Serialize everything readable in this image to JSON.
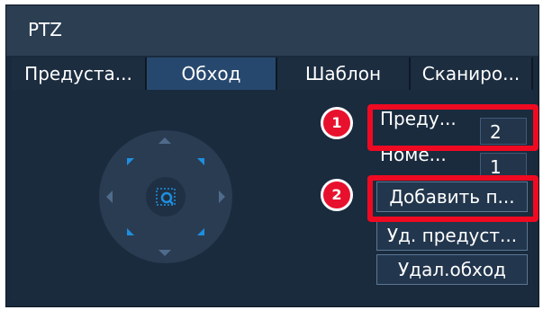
{
  "window": {
    "title": "PTZ"
  },
  "tabs": [
    {
      "label": "Предуста...",
      "active": false
    },
    {
      "label": "Обход",
      "active": true
    },
    {
      "label": "Шаблон",
      "active": false
    },
    {
      "label": "Сканиро...",
      "active": false
    }
  ],
  "dpad": {
    "center_icon": "zoom-focus-icon",
    "direction_icons": [
      "up",
      "down",
      "left",
      "right",
      "up-left",
      "up-right",
      "down-left",
      "down-right"
    ]
  },
  "fields": {
    "preset": {
      "label": "Преду...",
      "value": "2"
    },
    "number": {
      "label": "Номе...",
      "value": "1"
    }
  },
  "buttons": {
    "add": "Добавить п...",
    "delete_preset": "Уд. предуст...",
    "delete_tour": "Удал.обход"
  },
  "callouts": {
    "one": "1",
    "two": "2"
  },
  "colors": {
    "background": "#1a2a3d",
    "active_tab": "#27486e",
    "accent_blue": "#1e8fe0",
    "highlight_red": "#ef0a22"
  }
}
